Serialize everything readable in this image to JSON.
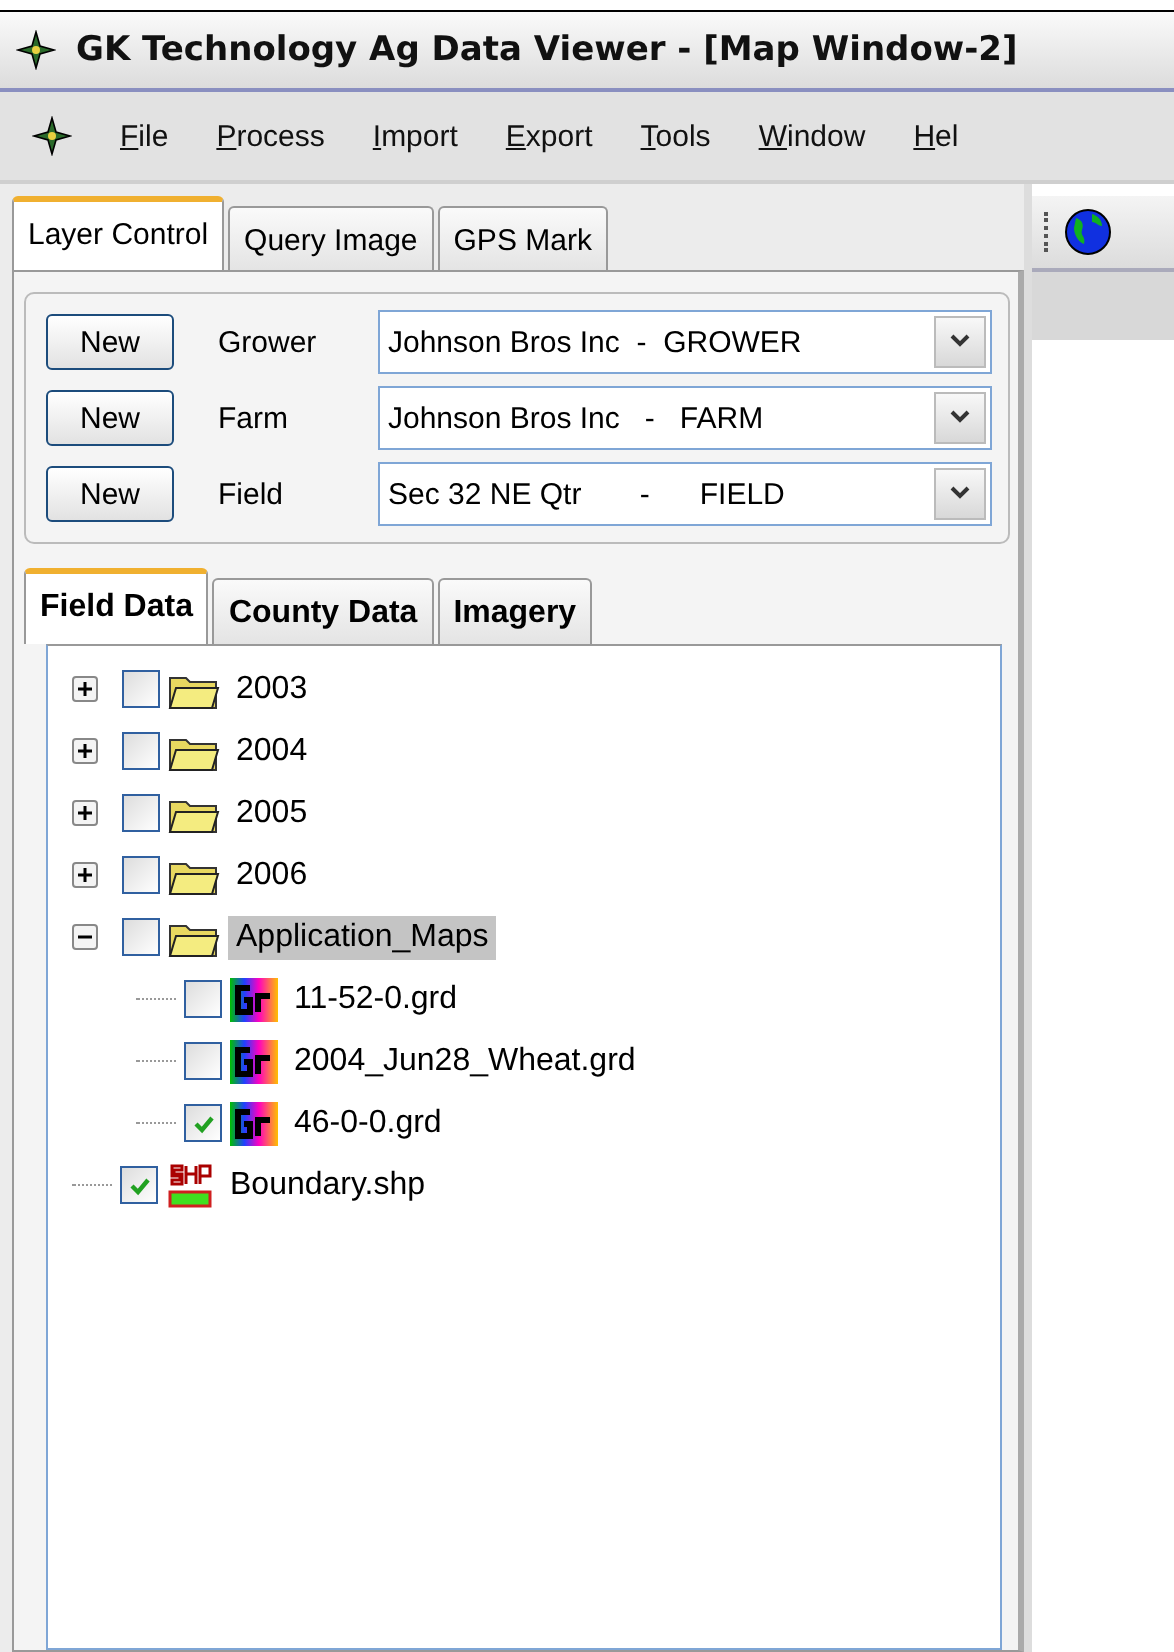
{
  "window": {
    "title": "GK Technology Ag Data Viewer - [Map Window-2]"
  },
  "menu": [
    {
      "label": "File"
    },
    {
      "label": "Process"
    },
    {
      "label": "Import"
    },
    {
      "label": "Export"
    },
    {
      "label": "Tools"
    },
    {
      "label": "Window"
    },
    {
      "label": "Hel"
    }
  ],
  "tabs": [
    {
      "label": "Layer Control",
      "selected": true
    },
    {
      "label": "Query Image",
      "selected": false
    },
    {
      "label": "GPS Mark",
      "selected": false
    }
  ],
  "selectors": [
    {
      "button": "New",
      "label": "Grower",
      "value": "Johnson Bros Inc  -  GROWER"
    },
    {
      "button": "New",
      "label": "Farm",
      "value": "Johnson Bros Inc   -   FARM"
    },
    {
      "button": "New",
      "label": "Field",
      "value": "Sec 32 NE Qtr       -      FIELD"
    }
  ],
  "data_tabs": [
    {
      "label": "Field Data",
      "selected": true
    },
    {
      "label": "County Data",
      "selected": false
    },
    {
      "label": "Imagery",
      "selected": false
    }
  ],
  "tree": [
    {
      "kind": "folder",
      "label": "2003",
      "checked": false,
      "selected": false,
      "expanded": false
    },
    {
      "kind": "folder",
      "label": "2004",
      "checked": false,
      "selected": false,
      "expanded": false
    },
    {
      "kind": "folder",
      "label": "2005",
      "checked": false,
      "selected": false,
      "expanded": false
    },
    {
      "kind": "folder",
      "label": "2006",
      "checked": false,
      "selected": false,
      "expanded": false
    },
    {
      "kind": "folder",
      "label": "Application_Maps",
      "checked": false,
      "selected": true,
      "expanded": true,
      "children": [
        {
          "kind": "grid",
          "label": "11-52-0.grd",
          "checked": false,
          "selected": false
        },
        {
          "kind": "grid",
          "label": "2004_Jun28_Wheat.grd",
          "checked": false,
          "selected": false
        },
        {
          "kind": "grid",
          "label": "46-0-0.grd",
          "checked": true,
          "selected": false
        }
      ]
    },
    {
      "kind": "shape",
      "label": "Boundary.shp",
      "checked": true,
      "selected": false
    }
  ]
}
